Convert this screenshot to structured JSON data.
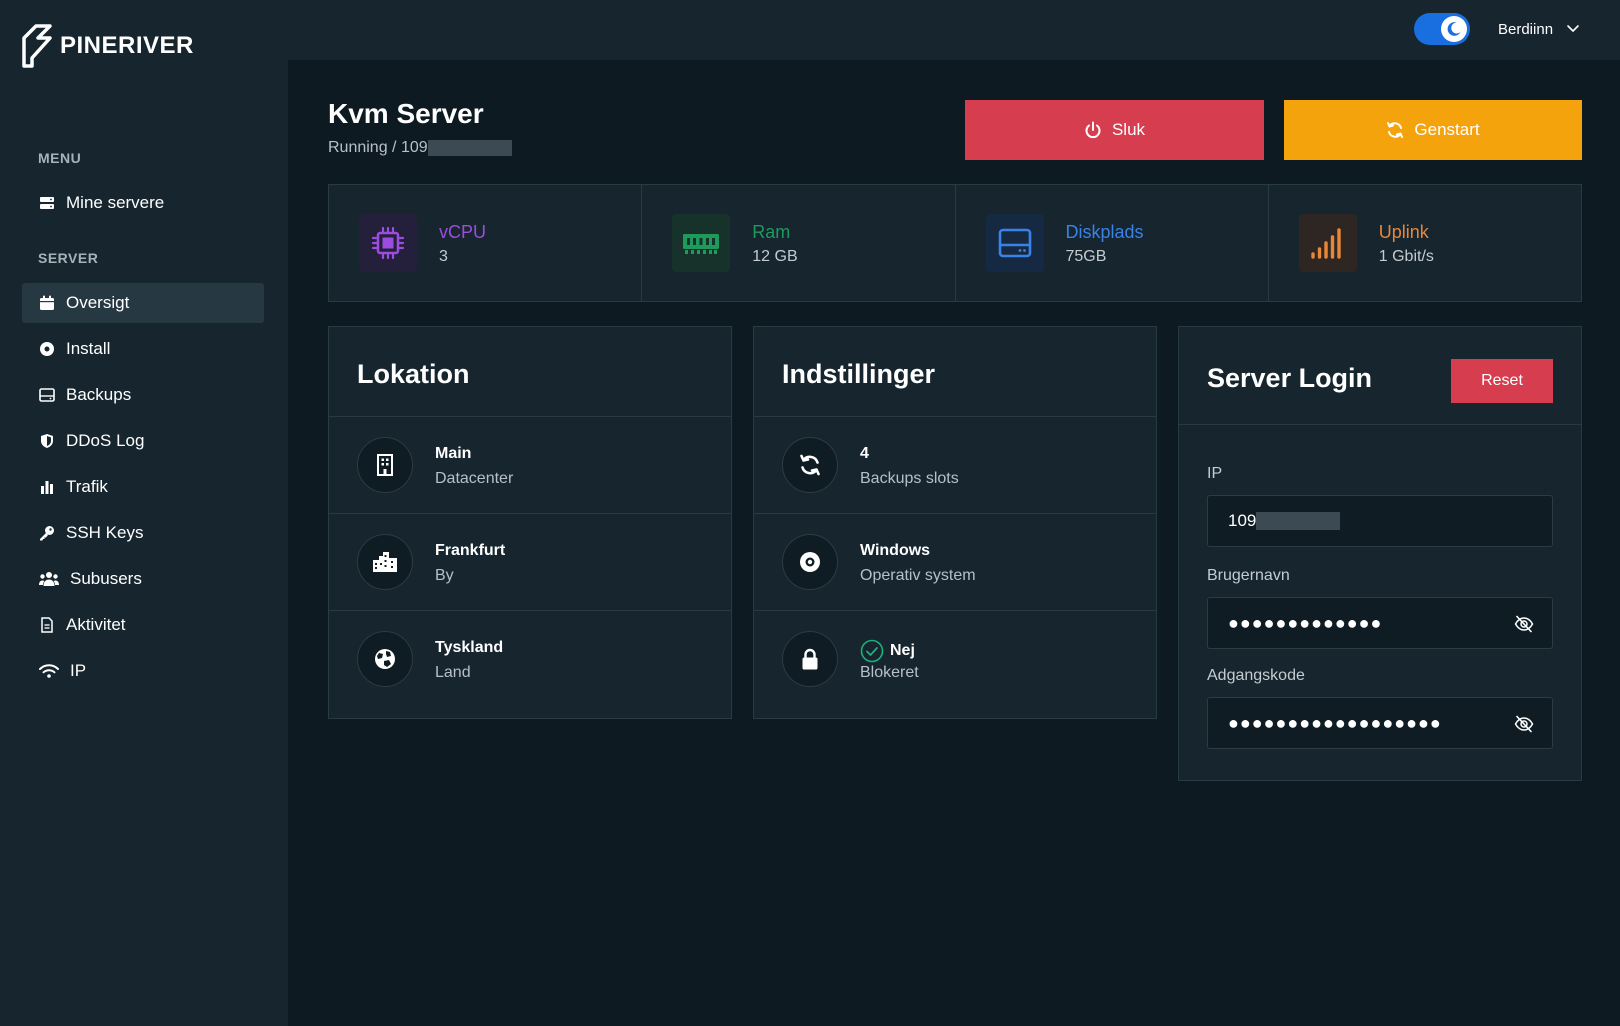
{
  "brand": {
    "name": "PINERIVER"
  },
  "topbar": {
    "user_name": "Berdiinn",
    "theme_toggle_icon": "moon-icon"
  },
  "sidebar": {
    "menu_label": "MENU",
    "menu_items": [
      {
        "label": "Mine servere",
        "icon": "server-icon"
      }
    ],
    "server_label": "SERVER",
    "server_items": [
      {
        "label": "Oversigt",
        "icon": "calendar-icon",
        "active": true
      },
      {
        "label": "Install",
        "icon": "disc-icon"
      },
      {
        "label": "Backups",
        "icon": "hdd-icon"
      },
      {
        "label": "DDoS Log",
        "icon": "shield-icon"
      },
      {
        "label": "Trafik",
        "icon": "bar-chart-icon"
      },
      {
        "label": "SSH Keys",
        "icon": "key-icon"
      },
      {
        "label": "Subusers",
        "icon": "users-icon"
      },
      {
        "label": "Aktivitet",
        "icon": "document-icon"
      },
      {
        "label": "IP",
        "icon": "wifi-icon"
      }
    ]
  },
  "header": {
    "title": "Kvm Server",
    "subtitle": "Running / 109",
    "btn_sluk": "Sluk",
    "btn_genstart": "Genstart"
  },
  "stats": [
    {
      "label": "vCPU",
      "value": "3",
      "icon": "cpu-icon",
      "color": "#9b4de0"
    },
    {
      "label": "Ram",
      "value": "12 GB",
      "icon": "memory-icon",
      "color": "#1e9a5c"
    },
    {
      "label": "Diskplads",
      "value": "75GB",
      "icon": "hdd-icon",
      "color": "#3b82e6"
    },
    {
      "label": "Uplink",
      "value": "1 Gbit/s",
      "icon": "signal-icon",
      "color": "#e8873a"
    }
  ],
  "lokation": {
    "title": "Lokation",
    "rows": [
      {
        "main": "Main",
        "sub": "Datacenter",
        "icon": "building-icon"
      },
      {
        "main": "Frankfurt",
        "sub": "By",
        "icon": "city-icon"
      },
      {
        "main": "Tyskland",
        "sub": "Land",
        "icon": "globe-icon"
      }
    ]
  },
  "indstillinger": {
    "title": "Indstillinger",
    "rows": [
      {
        "main": "4",
        "sub": "Backups slots",
        "icon": "refresh-icon"
      },
      {
        "main": "Windows",
        "sub": "Operativ system",
        "icon": "disc-icon"
      },
      {
        "main": "Nej",
        "sub": "Blokeret",
        "icon": "lock-icon"
      }
    ]
  },
  "login": {
    "title": "Server Login",
    "reset_label": "Reset",
    "ip_label": "IP",
    "ip_value": "109",
    "username_label": "Brugernavn",
    "username_value": "●●●●●●●●●●●●●",
    "password_label": "Adgangskode",
    "password_value": "●●●●●●●●●●●●●●●●●●"
  },
  "colors": {
    "danger": "#d63e50",
    "warning": "#f5a30d",
    "accent": "#1a6fe0",
    "success": "#1e9a5c"
  }
}
